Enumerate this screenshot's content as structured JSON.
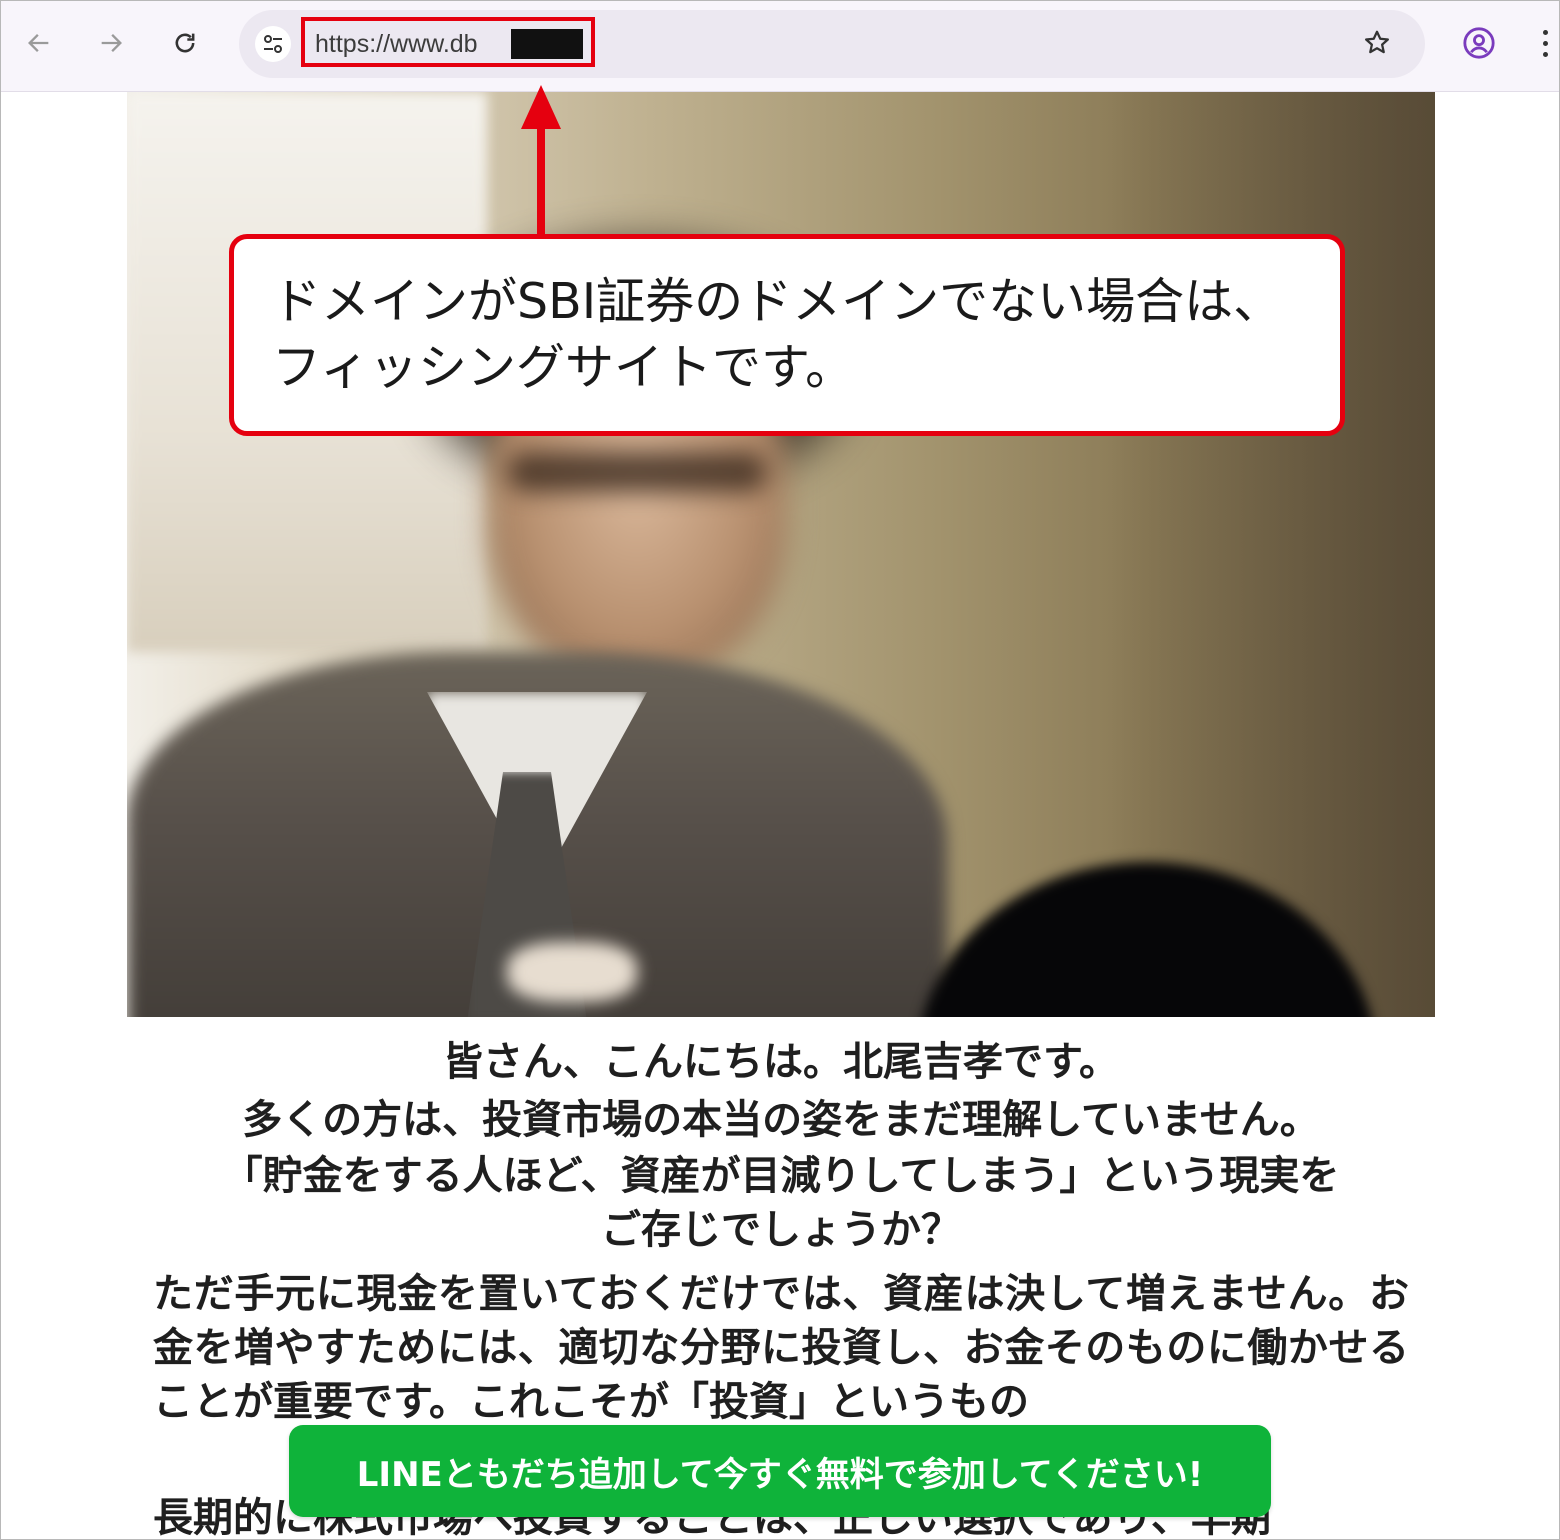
{
  "browser": {
    "url": "https://www.db",
    "icons": {
      "back": "arrow-left-icon",
      "forward": "arrow-right-icon",
      "reload": "reload-icon",
      "site_info": "tune-icon",
      "bookmark": "star-icon",
      "profile": "account-circle-icon",
      "menu": "kebab-menu-icon"
    }
  },
  "annotation": {
    "text": "ドメインがSBI証券のドメインでない場合は、\nフィッシングサイトです。",
    "color": "#e5000f"
  },
  "article": {
    "intro": [
      "皆さん、こんにちは。北尾吉孝です。",
      "多くの方は、投資市場の本当の姿をまだ理解していません。",
      "「貯金をする人ほど、資産が目減りしてしまう」という現実を",
      "ご存じでしょうか？"
    ],
    "paragraph1": "ただ手元に現金を置いておくだけでは、資産は決して増えません。お金を増やすためには、適切な分野に投資し、お金そのものに働かせることが重要です。これこそが「投資」というもの",
    "paragraph2": "長期的に株式市場へ投資することは、正しい選択であり、早期"
  },
  "cta": {
    "label": "LINEともだち追加して今すぐ無料で参加してください!",
    "color": "#0fb33a"
  }
}
